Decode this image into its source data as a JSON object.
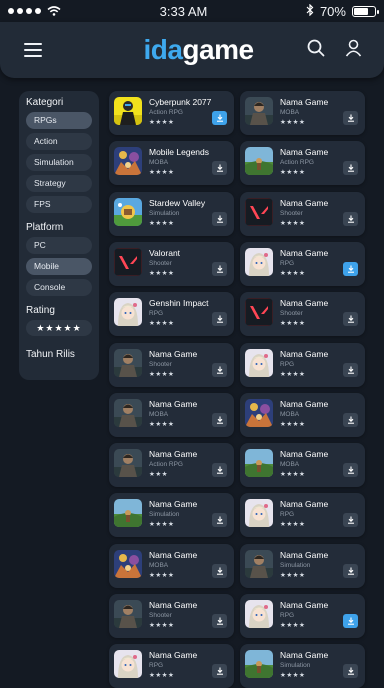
{
  "status": {
    "time": "3:33 AM",
    "battery": "70%",
    "battery_level": 0.7
  },
  "header": {
    "logo_part1": "ida",
    "logo_part2": "game"
  },
  "sidebar": {
    "kategori_title": "Kategori",
    "kategori": [
      {
        "label": "RPGs",
        "active": true
      },
      {
        "label": "Action",
        "active": false
      },
      {
        "label": "Simulation",
        "active": false
      },
      {
        "label": "Strategy",
        "active": false
      },
      {
        "label": "FPS",
        "active": false
      }
    ],
    "platform_title": "Platform",
    "platform": [
      {
        "label": "PC",
        "active": false
      },
      {
        "label": "Mobile",
        "active": true
      },
      {
        "label": "Console",
        "active": false
      }
    ],
    "rating_title": "Rating",
    "rating_stars": "★★★★★",
    "tahun_title": "Tahun Rilis"
  },
  "games": [
    {
      "name": "Cyberpunk 2077",
      "genre": "Action RPG",
      "stars": "★★★★",
      "thumb": "cyber",
      "download": "blue"
    },
    {
      "name": "Nama Game",
      "genre": "MOBA",
      "stars": "★★★★",
      "thumb": "knight",
      "download": "gray"
    },
    {
      "name": "Mobile Legends",
      "genre": "MOBA",
      "stars": "★★★★",
      "thumb": "legend",
      "download": "gray"
    },
    {
      "name": "Nama Game",
      "genre": "Action RPG",
      "stars": "★★★★",
      "thumb": "field",
      "download": "gray"
    },
    {
      "name": "Stardew Valley",
      "genre": "Simulation",
      "stars": "★★★★",
      "thumb": "stardew",
      "download": "gray"
    },
    {
      "name": "Nama Game",
      "genre": "Shooter",
      "stars": "★★★★",
      "thumb": "valorant",
      "download": "gray"
    },
    {
      "name": "Valorant",
      "genre": "Shooter",
      "stars": "★★★★",
      "thumb": "valorant",
      "download": "gray"
    },
    {
      "name": "Nama Game",
      "genre": "RPG",
      "stars": "★★★★",
      "thumb": "anime",
      "download": "blue"
    },
    {
      "name": "Genshin Impact",
      "genre": "RPG",
      "stars": "★★★★",
      "thumb": "anime",
      "download": "gray"
    },
    {
      "name": "Nama Game",
      "genre": "Shooter",
      "stars": "★★★★",
      "thumb": "valorant",
      "download": "gray"
    },
    {
      "name": "Nama Game",
      "genre": "Shooter",
      "stars": "★★★★",
      "thumb": "knight",
      "download": "gray"
    },
    {
      "name": "Nama Game",
      "genre": "RPG",
      "stars": "★★★★",
      "thumb": "anime",
      "download": "gray"
    },
    {
      "name": "Nama Game",
      "genre": "MOBA",
      "stars": "★★★★",
      "thumb": "knight",
      "download": "gray"
    },
    {
      "name": "Nama Game",
      "genre": "MOBA",
      "stars": "★★★★",
      "thumb": "legend",
      "download": "gray"
    },
    {
      "name": "Nama Game",
      "genre": "Action RPG",
      "stars": "★★★",
      "thumb": "knight",
      "download": "gray"
    },
    {
      "name": "Nama Game",
      "genre": "MOBA",
      "stars": "★★★★",
      "thumb": "field",
      "download": "gray"
    },
    {
      "name": "Nama Game",
      "genre": "Simulation",
      "stars": "★★★★",
      "thumb": "field",
      "download": "gray"
    },
    {
      "name": "Nama Game",
      "genre": "RPG",
      "stars": "★★★★",
      "thumb": "anime",
      "download": "gray"
    },
    {
      "name": "Nama Game",
      "genre": "MOBA",
      "stars": "★★★★",
      "thumb": "legend",
      "download": "gray"
    },
    {
      "name": "Nama Game",
      "genre": "Simulation",
      "stars": "★★★★",
      "thumb": "knight",
      "download": "gray"
    },
    {
      "name": "Nama Game",
      "genre": "Shooter",
      "stars": "★★★★",
      "thumb": "knight",
      "download": "gray"
    },
    {
      "name": "Nama Game",
      "genre": "RPG",
      "stars": "★★★★",
      "thumb": "anime",
      "download": "blue"
    },
    {
      "name": "Nama Game",
      "genre": "RPG",
      "stars": "★★★★",
      "thumb": "anime",
      "download": "gray"
    },
    {
      "name": "Nama Game",
      "genre": "Simulation",
      "stars": "★★★★",
      "thumb": "field",
      "download": "gray"
    }
  ],
  "colors": {
    "accent": "#3ea9ee",
    "background": "#141a23",
    "card": "#232c39"
  }
}
